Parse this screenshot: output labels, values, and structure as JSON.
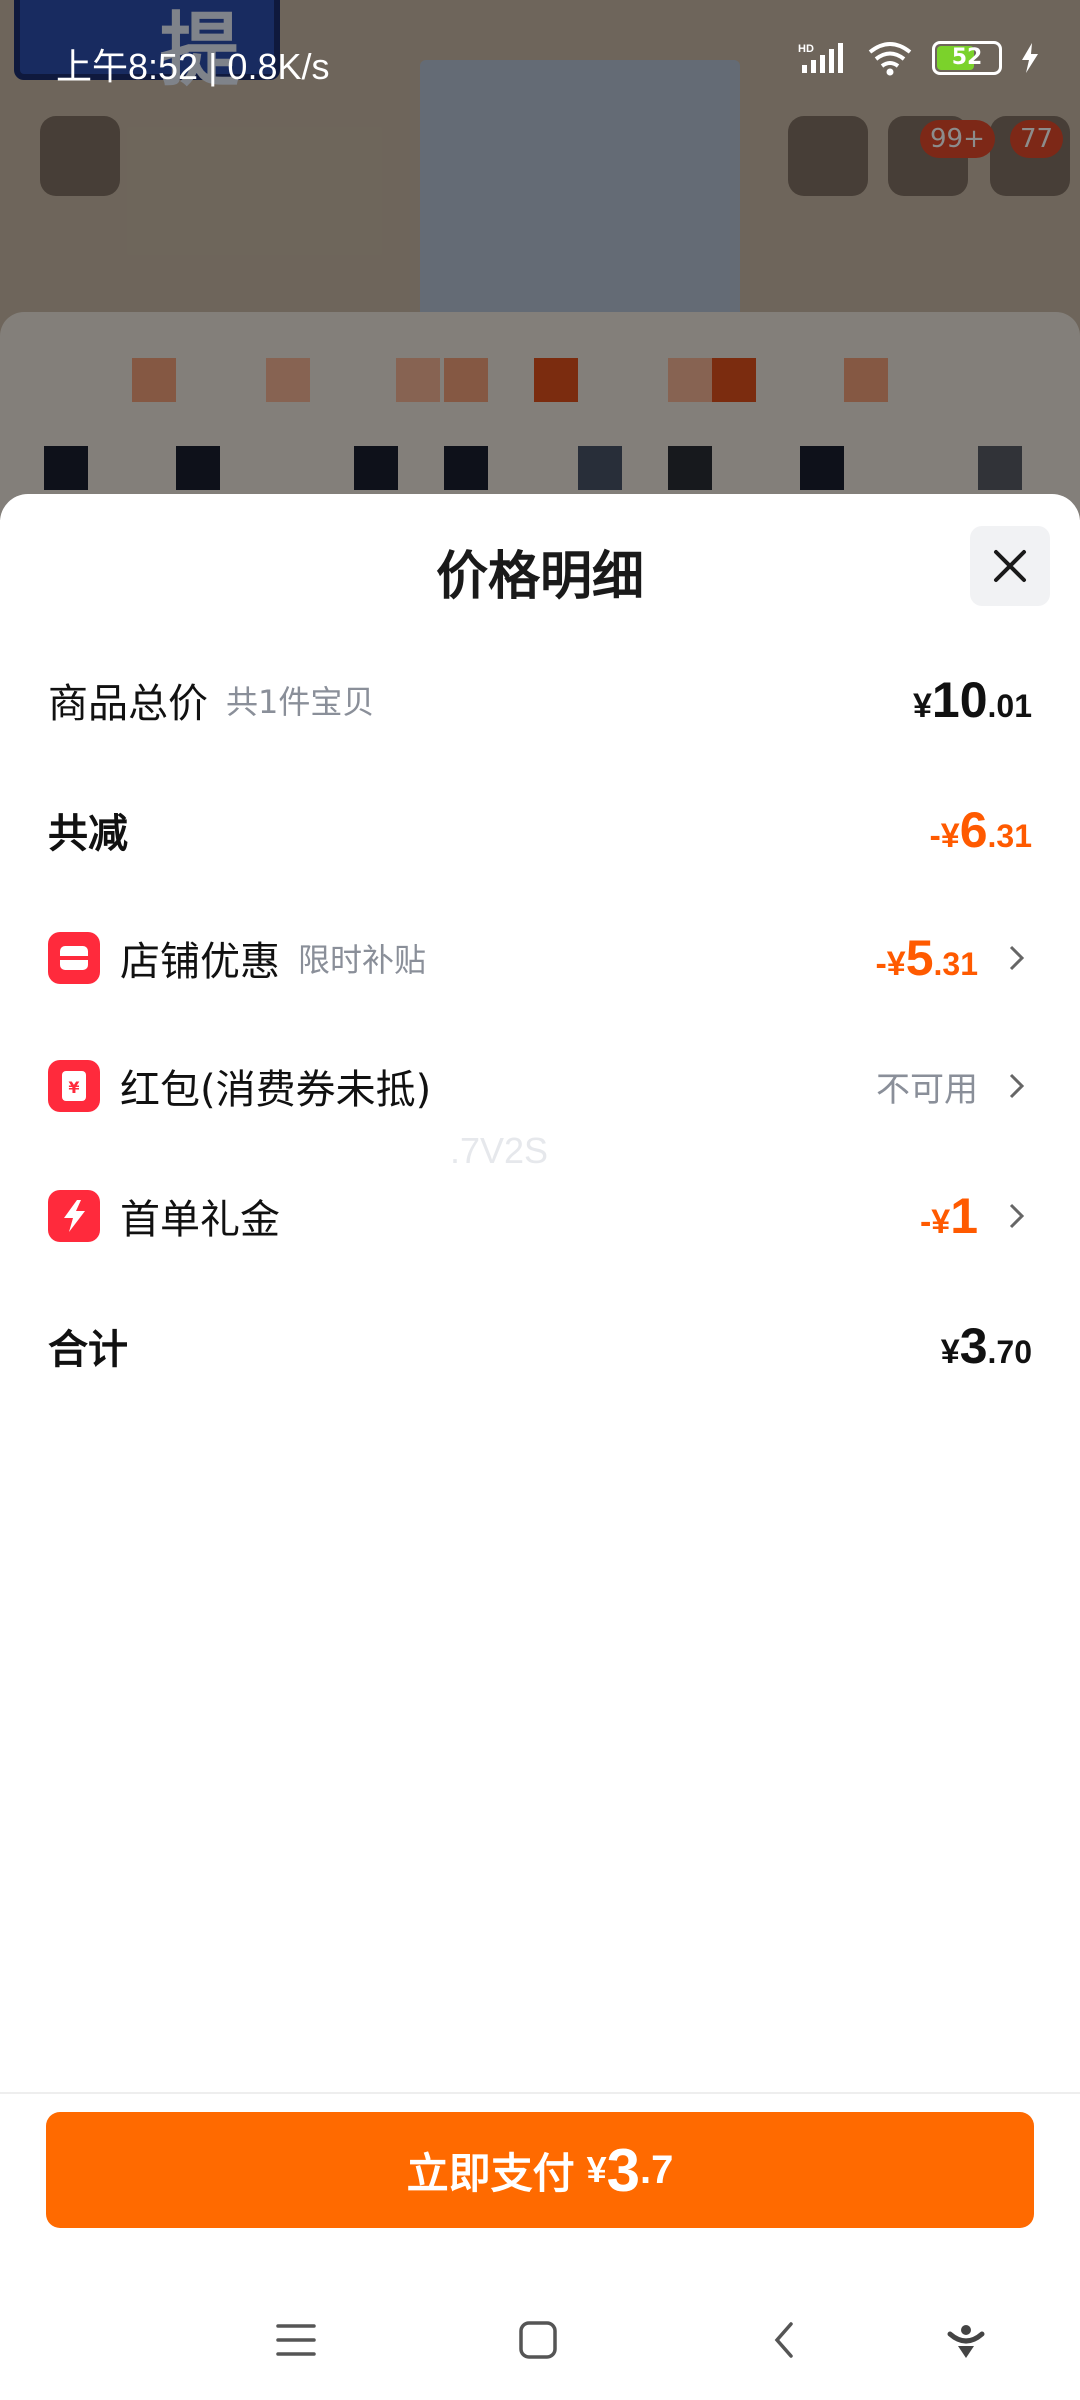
{
  "status_bar": {
    "time": "上午8:52 | 0.8K/s",
    "battery_level": "52",
    "icons": [
      "hd-signal-icon",
      "wifi-icon",
      "battery-icon",
      "charging-icon"
    ]
  },
  "background": {
    "sign_text": "提",
    "cart_badge": "99+",
    "msg_badge": "77"
  },
  "sheet": {
    "title": "价格明细",
    "rows": {
      "total": {
        "label": "商品总价",
        "sub": "共1件宝贝",
        "sym": "¥",
        "int": "10",
        "dec": ".01"
      },
      "discount": {
        "label": "共减",
        "sym": "-¥",
        "int": "6",
        "dec": ".31"
      },
      "shop": {
        "label": "店铺优惠",
        "sub": "限时补贴",
        "sym": "-¥",
        "int": "5",
        "dec": ".31"
      },
      "redpacket": {
        "label": "红包(消费券未抵)",
        "value": "不可用"
      },
      "firstorder": {
        "label": "首单礼金",
        "sym": "-¥",
        "int": "1"
      },
      "sum": {
        "label": "合计",
        "sym": "¥",
        "int": "3",
        "dec": ".70"
      }
    },
    "watermark": ".7V2S"
  },
  "footer": {
    "pay_label": "立即支付",
    "pay_sym": "¥",
    "pay_int": "3",
    "pay_dec": ".7"
  },
  "colors": {
    "accent": "#ff6a00",
    "discount": "#ff5a00",
    "icon_red": "#ff2a3c"
  }
}
